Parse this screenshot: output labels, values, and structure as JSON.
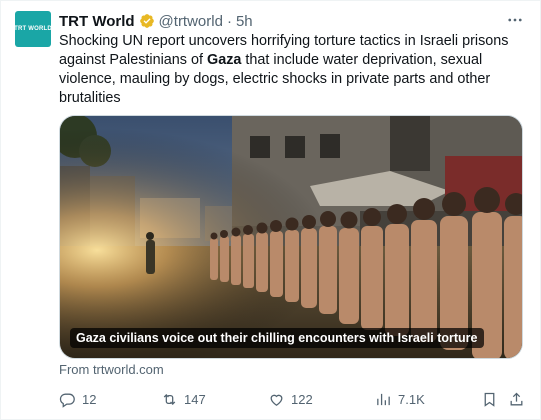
{
  "author": {
    "avatar_text": "TRT WORLD",
    "name": "TRT World",
    "handle": "@trtworld",
    "separator": "·",
    "time": "5h"
  },
  "tweet": {
    "text_before": "Shocking UN report uncovers horrifying torture tactics in Israeli prisons against Palestinians of ",
    "text_bold": "Gaza",
    "text_after": " that include water deprivation, sexual violence, mauling by dogs, electric shocks in private parts and other brutalities"
  },
  "media": {
    "caption": "Gaza civilians voice out their chilling encounters with Israeli torture"
  },
  "source": "From trtworld.com",
  "actions": {
    "replies": "12",
    "reposts": "147",
    "likes": "122",
    "views": "7.1K"
  },
  "colors": {
    "avatar_bg": "#1aa6a6",
    "verified_badge": "#e8b824",
    "muted_text": "#536471"
  },
  "icons": [
    "more-icon",
    "verified-badge-icon",
    "reply-icon",
    "repost-icon",
    "like-icon",
    "views-icon",
    "bookmark-icon",
    "share-icon"
  ]
}
